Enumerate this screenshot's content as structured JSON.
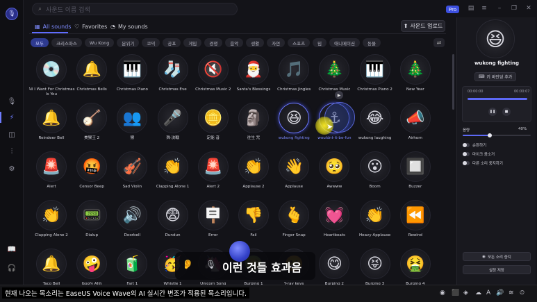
{
  "search": {
    "placeholder": "사운드 이름 검색",
    "icon": "search-icon"
  },
  "header": {
    "pro_badge": "Pro"
  },
  "tabs": [
    {
      "label": "All sounds",
      "icon": "grid-icon"
    },
    {
      "label": "Favorites",
      "icon": "heart-icon"
    },
    {
      "label": "My sounds",
      "icon": "user-icon"
    }
  ],
  "upload_label": "사운드 업로드",
  "categories": [
    "모두",
    "크리스마스",
    "Wu Kong",
    "분위기",
    "코믹",
    "공포",
    "게임",
    "경쟁",
    "음악",
    "생활",
    "자연",
    "스포츠",
    "밈",
    "애니메이션",
    "동물"
  ],
  "sounds": [
    {
      "label": "All I Want For Christmas Is You",
      "emoji": "💿"
    },
    {
      "label": "Christmas Bells",
      "emoji": "🔔"
    },
    {
      "label": "Christmas Piano",
      "emoji": "🎹"
    },
    {
      "label": "Christmas Eve",
      "emoji": "🧦"
    },
    {
      "label": "Christmas Music 2",
      "emoji": "🔇"
    },
    {
      "label": "Santa's Blessings",
      "emoji": "🎅"
    },
    {
      "label": "Christmas Jingles",
      "emoji": "🎵"
    },
    {
      "label": "Christmas Music",
      "emoji": "🎄"
    },
    {
      "label": "Christmas Piano 2",
      "emoji": "🎹"
    },
    {
      "label": "New Year",
      "emoji": "🎄"
    },
    {
      "label": "Reindeer Bell",
      "emoji": "🔔"
    },
    {
      "label": "美猴王 2",
      "emoji": "🪕"
    },
    {
      "label": "猴",
      "emoji": "👥"
    },
    {
      "label": "殊·決戰",
      "emoji": "🎤"
    },
    {
      "label": "定能 音",
      "emoji": "🪙"
    },
    {
      "label": "往生 咒",
      "emoji": "🗿"
    },
    {
      "label": "wukong fighting",
      "emoji": "😆",
      "selected": true
    },
    {
      "label": "wouldnt-it-be-fun",
      "emoji": "⚓",
      "selected": true
    },
    {
      "label": "wukong laughing",
      "emoji": "😂"
    },
    {
      "label": "Airhorn",
      "emoji": "📣"
    },
    {
      "label": "Alert",
      "emoji": "🚨"
    },
    {
      "label": "Censor Beep",
      "emoji": "🤬"
    },
    {
      "label": "Sad Violin",
      "emoji": "🎻"
    },
    {
      "label": "Clapping Alone 1",
      "emoji": "👏"
    },
    {
      "label": "Alert 2",
      "emoji": "🚨"
    },
    {
      "label": "Applause 2",
      "emoji": "👏"
    },
    {
      "label": "Applause",
      "emoji": "👋"
    },
    {
      "label": "Awwww",
      "emoji": "🥺"
    },
    {
      "label": "Boom",
      "emoji": "😮"
    },
    {
      "label": "Buzzer",
      "emoji": "🔲"
    },
    {
      "label": "Clapping Alone 2",
      "emoji": "👏"
    },
    {
      "label": "Dialup",
      "emoji": "📟"
    },
    {
      "label": "Doorbell",
      "emoji": "🔊"
    },
    {
      "label": "Dundun",
      "emoji": "😨"
    },
    {
      "label": "Error",
      "emoji": "🪧"
    },
    {
      "label": "Fail",
      "emoji": "👎"
    },
    {
      "label": "Finger Snap",
      "emoji": "🫰"
    },
    {
      "label": "Heartbeats",
      "emoji": "💓"
    },
    {
      "label": "Heavy Applause",
      "emoji": "👏"
    },
    {
      "label": "Rewind",
      "emoji": "⏪"
    },
    {
      "label": "Taco Bell",
      "emoji": "🔔"
    },
    {
      "label": "Goofy Ahh",
      "emoji": "🤪"
    },
    {
      "label": "Fart 1",
      "emoji": "🧃"
    },
    {
      "label": "Whistle 1",
      "emoji": "🥳"
    },
    {
      "label": "Unicorn Song",
      "emoji": "🦄"
    },
    {
      "label": "Burping 1",
      "emoji": "🤢"
    },
    {
      "label": "Y-ray keys",
      "emoji": "😬"
    },
    {
      "label": "Burping 2",
      "emoji": "😋"
    },
    {
      "label": "Burping 3",
      "emoji": "😝"
    },
    {
      "label": "Burping 4",
      "emoji": "🤮"
    }
  ],
  "panel": {
    "title": "wukong fighting",
    "emoji": "😆",
    "hotkey_label": "키 바인딩 추가",
    "time_start": "00:00:00",
    "time_end": "00:00:07",
    "volume_label": "음량",
    "volume_value": "40%",
    "volume_level": 0.4,
    "options": [
      "순환하기",
      "마이크 음소거",
      "다른 소리 중지하기"
    ],
    "stop_all_label": "모든 소리 중지",
    "save_label": "설정 저장"
  },
  "caption": {
    "text": "이런 것들 효과음"
  },
  "taskbar": {
    "subtitle": "현재 나오는 목소리는 EaseUS Voice Wave의 AI 실시간 변조가 적용된 목소리입니다."
  },
  "colors": {
    "accent": "#5f6cff",
    "background": "#131318",
    "panel": "#18181e"
  }
}
